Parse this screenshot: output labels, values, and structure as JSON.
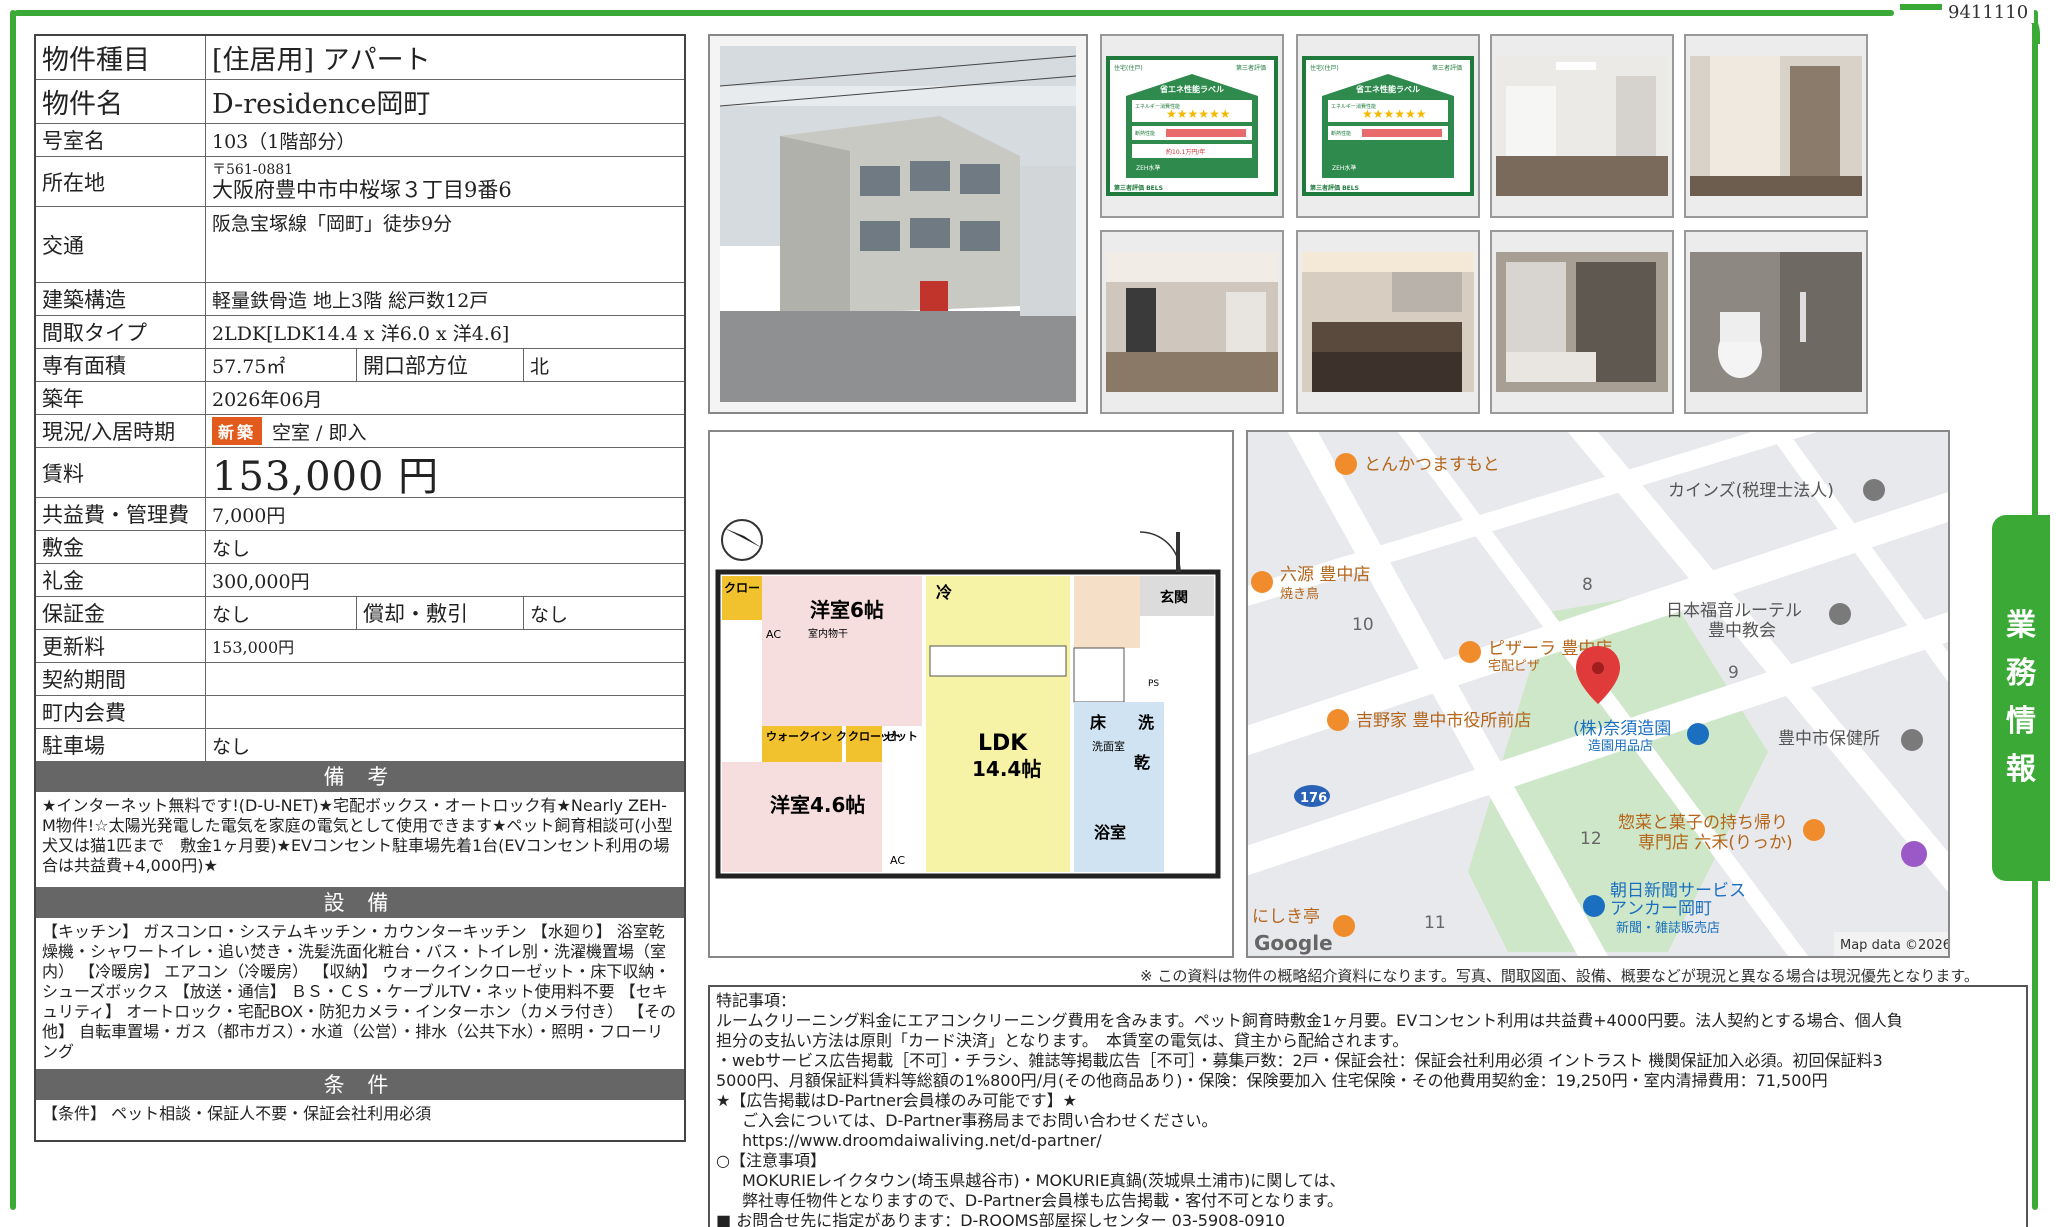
{
  "page_number": "9411110",
  "side_tab": [
    "業",
    "務",
    "情",
    "報"
  ],
  "spec": {
    "type": {
      "label": "物件種目",
      "value": "[住居用] アパート"
    },
    "name": {
      "label": "物件名",
      "value": "D-residence岡町"
    },
    "room": {
      "label": "号室名",
      "value": "103（1階部分）"
    },
    "address": {
      "label": "所在地",
      "zip": "〒561-0881",
      "value": "大阪府豊中市中桜塚３丁目9番6"
    },
    "traffic": {
      "label": "交通",
      "value": "阪急宝塚線「岡町」徒歩9分"
    },
    "structure": {
      "label": "建築構造",
      "value": "軽量鉄骨造 地上3階 総戸数12戸"
    },
    "layout": {
      "label": "間取タイプ",
      "value": "2LDK[LDK14.4 x 洋6.0 x 洋4.6]"
    },
    "area": {
      "label": "専有面積",
      "value": "57.75㎡",
      "sub_label": "開口部方位",
      "sub_value": "北"
    },
    "built": {
      "label": "築年",
      "value": "2026年06月"
    },
    "status": {
      "label": "現況/入居時期",
      "badge": "新築",
      "value": "空室 / 即入"
    },
    "rent": {
      "label": "賃料",
      "value": "153,000 円"
    },
    "common_fee": {
      "label": "共益費・管理費",
      "value": "7,000円"
    },
    "deposit": {
      "label": "敷金",
      "value": "なし"
    },
    "key_money": {
      "label": "礼金",
      "value": "300,000円"
    },
    "guarantee": {
      "label": "保証金",
      "value": "なし",
      "sub_label": "償却・敷引",
      "sub_value": "なし"
    },
    "renewal": {
      "label": "更新料",
      "value": "153,000円"
    },
    "contract": {
      "label": "契約期間",
      "value": ""
    },
    "town_fee": {
      "label": "町内会費",
      "value": ""
    },
    "parking": {
      "label": "駐車場",
      "value": "なし"
    }
  },
  "remarks": {
    "title": "備 考",
    "text": "★インターネット無料です!(D-U-NET)★宅配ボックス・オートロック有★Nearly ZEH-M物件!☆太陽光発電した電気を家庭の電気として使用できます★ペット飼育相談可(小型犬又は猫1匹まで　敷金1ヶ月要)★EVコンセント駐車場先着1台(EVコンセント利用の場合は共益費+4,000円)★"
  },
  "equipment": {
    "title": "設 備",
    "text": "【キッチン】 ガスコンロ・システムキッチン・カウンターキッチン 【水廻り】 浴室乾燥機・シャワートイレ・追い焚き・洗髪洗面化粧台・バス・トイレ別・洗濯機置場（室内） 【冷暖房】 エアコン（冷暖房） 【収納】 ウォークインクローゼット・床下収納・シューズボックス 【放送・通信】 ＢＳ・ＣＳ・ケーブルTV・ネット使用料不要 【セキュリティ】 オートロック・宅配BOX・防犯カメラ・インターホン（カメラ付き） 【その他】 自転車置場・ガス（都市ガス）・水道（公営）・排水（公共下水）・照明・フローリング"
  },
  "conditions": {
    "title": "条 件",
    "text": "【条件】 ペット相談・保証人不要・保証会社利用必須"
  },
  "energy_label": {
    "header_left": "住宅(住戸)",
    "header_right": "第三者評価",
    "title": "省エネ性能ラベル",
    "row1": "エネルギー消費性能",
    "row2": "断熱性能",
    "cost": "約10.1万円/年",
    "zeh": "ZEH水準",
    "footer": "第三者評価 BELS"
  },
  "floorplan": {
    "closet_a": "クロー\nゼット",
    "western_a": "洋室6帖",
    "indoor_dry": "室内物干",
    "walkin": "ウォークイン\nクローゼット",
    "closet_b": "クロー\nゼット",
    "western_b": "洋室4.6帖",
    "ldk": "LDK",
    "ldk_size": "14.4帖",
    "fridge": "冷",
    "entrance": "玄関",
    "floor_storage": "床",
    "washroom": "洗面室",
    "wash": "洗",
    "dryer": "乾",
    "bath": "浴室",
    "ac": "AC",
    "ps": "PS"
  },
  "map": {
    "places": [
      {
        "name": "とんかつますもと"
      },
      {
        "name": "カインズ(税理士法人)"
      },
      {
        "name": "六源 豊中店",
        "sub": "焼き鳥"
      },
      {
        "name": "日本福音ルーテル",
        "sub": "豊中教会"
      },
      {
        "name": "ピザーラ 豊中店",
        "sub": "宅配ピザ"
      },
      {
        "name": "吉野家 豊中市役所前店"
      },
      {
        "name": "(株)奈須造園",
        "sub": "造園用品店"
      },
      {
        "name": "豊中市保健所"
      },
      {
        "name": "惣菜と菓子の持ち帰り",
        "sub": "専門店 六禾(りっか)"
      },
      {
        "name": "朝日新聞サービス",
        "sub": "アンカー岡町"
      },
      {
        "name": "新聞・雑誌販売店"
      },
      {
        "name": "にしき亭"
      }
    ],
    "block_numbers": [
      "8",
      "10",
      "9",
      "12",
      "11"
    ],
    "route": "176",
    "brand": "Google",
    "credit": "Map data ©2026"
  },
  "disclaimer": "※ この資料は物件の概略紹介資料になります。写真、間取図面、設備、概要などが現況と異なる場合は現況優先となります。",
  "notes": {
    "l1": "特記事項：",
    "l2": "ルームクリーニング料金にエアコンクリーニング費用を含みます。ペット飼育時敷金1ヶ月要。EVコンセント利用は共益費+4000円要。法人契約とする場合、個人負",
    "l3": "担分の支払い方法は原則「カード決済」となります。　本賃室の電気は、貸主から配給されます。",
    "l4": "・webサービス広告掲載［不可］・チラシ、雑誌等掲載広告［不可］・募集戸数：2戸・保証会社：保証会社利用必須 イントラスト 機関保証加入必須。初回保証料3",
    "l5": "5000円、月額保証料賃料等総額の1%800円/月(その他商品あり)・保険：保険要加入 住宅保険・その他費用契約金：19,250円・室内清掃費用：71,500円",
    "l6": "★【広告掲載はD-Partner会員様のみ可能です】★",
    "l7": "ご入会については、D-Partner事務局までお問い合わせください。",
    "l8": "https://www.droomdaiwaliving.net/d-partner/",
    "l9": "○【注意事項】",
    "l10": "MOKURIEレイクタウン(埼玉県越谷市)・MOKURIE真鍋(茨城県土浦市)に関しては、",
    "l11": "弊社専任物件となりますので、D-Partner会員様も広告掲載・客付不可となります。",
    "l12": "■ お問合せ先に指定があります：D-ROOMS部屋探しセンター 03-5908-0910"
  }
}
